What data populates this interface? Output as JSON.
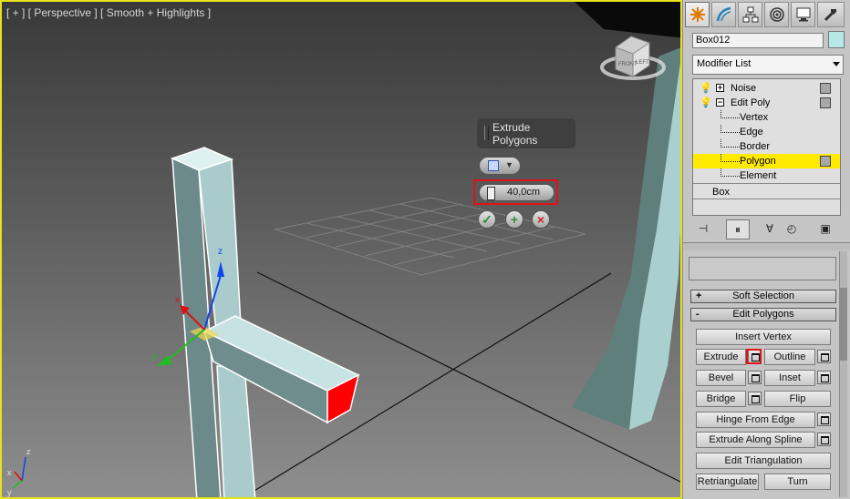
{
  "viewport": {
    "label": "[ + ] [ Perspective ] [ Smooth + Highlights ]",
    "viewcube_faces": [
      "FRONT",
      "LEFT"
    ],
    "axis": {
      "x": "x",
      "y": "y",
      "z": "z"
    },
    "colors": {
      "selected_face": "#ff0000",
      "gizmo_x": "#dd1111",
      "gizmo_y": "#22bb22",
      "gizmo_z": "#1144ee",
      "border": "#e8e21e"
    }
  },
  "caddy": {
    "title": "Extrude Polygons",
    "mode_icon": "group-icon",
    "height_value": "40,0cm",
    "ok_icon": "checkmark-icon",
    "apply_icon": "plus-icon",
    "cancel_icon": "x-icon"
  },
  "panel": {
    "tabs": [
      {
        "icon": "create-icon"
      },
      {
        "icon": "modify-icon"
      },
      {
        "icon": "hierarchy-icon"
      },
      {
        "icon": "motion-icon"
      },
      {
        "icon": "display-icon"
      },
      {
        "icon": "utilities-icon"
      }
    ],
    "object_name": "Box012",
    "object_color": "#b6e8e8",
    "modifier_list": "Modifier List",
    "stack": {
      "noise": "Noise",
      "edit_poly": "Edit Poly",
      "vertex": "Vertex",
      "edge": "Edge",
      "border": "Border",
      "polygon": "Polygon",
      "element": "Element",
      "box": "Box"
    },
    "stack_tools": [
      "pin-stack-icon",
      "show-end-result-icon",
      "make-unique-icon",
      "remove-modifier-icon",
      "configure-sets-icon"
    ],
    "rollups": {
      "soft_selection": {
        "sign": "+",
        "label": "Soft Selection"
      },
      "edit_polygons": {
        "sign": "-",
        "label": "Edit Polygons"
      }
    },
    "buttons": {
      "insert_vertex": "Insert Vertex",
      "extrude": "Extrude",
      "outline": "Outline",
      "bevel": "Bevel",
      "inset": "Inset",
      "bridge": "Bridge",
      "flip": "Flip",
      "hinge": "Hinge From Edge",
      "extrude_spline": "Extrude Along Spline",
      "edit_tri": "Edit Triangulation",
      "retriangulate": "Retriangulate",
      "turn": "Turn"
    }
  }
}
